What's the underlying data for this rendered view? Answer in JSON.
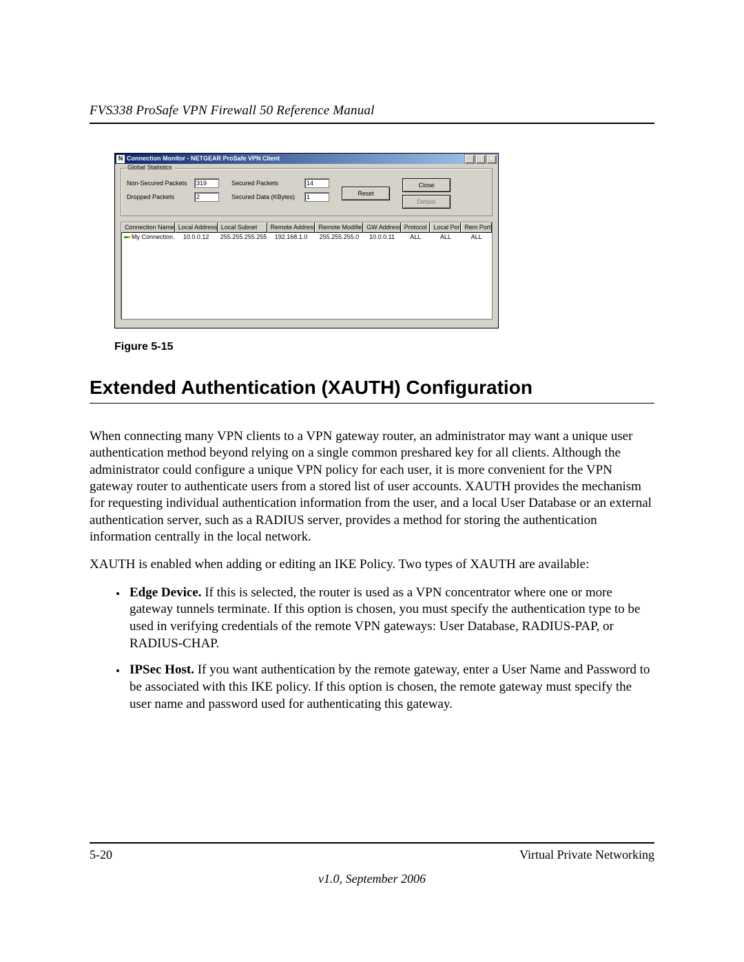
{
  "doc_header": "FVS338 ProSafe VPN Firewall 50 Reference Manual",
  "app": {
    "title": "Connection Monitor - NETGEAR ProSafe VPN Client",
    "icon_letter": "N",
    "group_legend": "Global Statistics",
    "labels": {
      "non_secured": "Non-Secured Packets",
      "dropped": "Dropped Packets",
      "secured": "Secured Packets",
      "secured_data": "Secured Data (KBytes)"
    },
    "values": {
      "non_secured": "319",
      "dropped": "2",
      "secured": "14",
      "secured_data": "1"
    },
    "buttons": {
      "reset": "Reset",
      "close": "Close",
      "details": "Details"
    },
    "columns": [
      "Connection Name",
      "Local Address",
      "Local Subnet",
      "Remote Address",
      "Remote Modifier",
      "GW Address",
      "Protocol",
      "Local Port",
      "Rem Port"
    ],
    "row": {
      "name": "My Connection…",
      "local_addr": "10.0.0.12",
      "local_subnet": "255.255.255.255",
      "remote_addr": "192.168.1.0",
      "remote_mod": "255.255.255.0",
      "gw": "10.0.0.11",
      "proto": "ALL",
      "lport": "ALL",
      "rport": "ALL"
    }
  },
  "figure_caption": "Figure 5-15",
  "section_heading": "Extended Authentication (XAUTH) Configuration",
  "paragraph1": "When connecting many VPN clients to a VPN gateway router, an administrator may want a unique user authentication method beyond relying on a single common preshared key for all clients. Although the administrator could configure a unique VPN policy for each user, it is more convenient for the VPN gateway router to authenticate users from a stored list of user accounts. XAUTH provides the mechanism for requesting individual authentication information from the user, and a local User Database or an external authentication server, such as a RADIUS server, provides a method for storing the authentication information centrally in the local network.",
  "paragraph2": "XAUTH is enabled when adding or editing an IKE Policy. Two types of XAUTH are available:",
  "bullets": {
    "b1_strong": "Edge Device.",
    "b1_rest": " If this is selected, the router is used as a VPN concentrator where one or more gateway tunnels terminate. If this option is chosen, you must specify the authentication type to be used in verifying credentials of the remote VPN gateways: User Database, RADIUS-PAP, or RADIUS-CHAP.",
    "b2_strong": "IPSec Host.",
    "b2_rest": " If you want authentication by the remote gateway, enter a User Name and Password to be associated with this IKE policy. If this option is chosen, the remote gateway must specify the user name and password used for authenticating this gateway."
  },
  "footer": {
    "page_num": "5-20",
    "section": "Virtual Private Networking",
    "version": "v1.0, September 2006"
  }
}
